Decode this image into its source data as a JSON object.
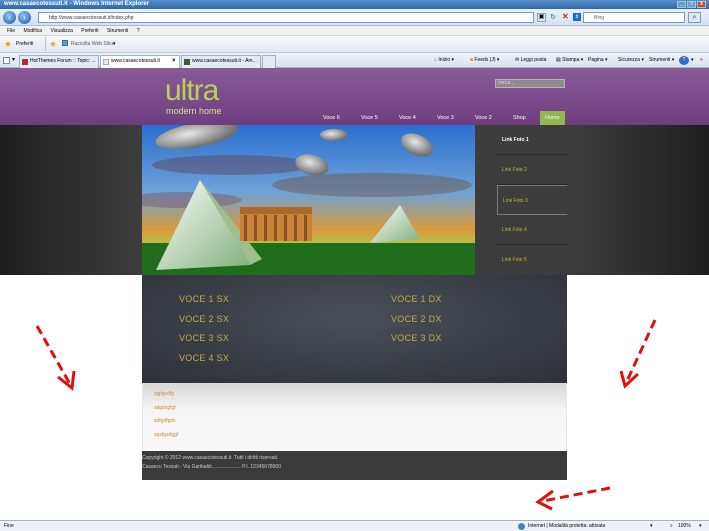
{
  "window": {
    "title": "www.casaecotessuti.it - Windows Internet Explorer"
  },
  "address": {
    "url": "http://www.casaecotessuti.it/index.php"
  },
  "search": {
    "placeholder": "Bing"
  },
  "menubar": [
    "File",
    "Modifica",
    "Visualizza",
    "Preferiti",
    "Strumenti",
    "?"
  ],
  "favbar": {
    "favorites": "Preferiti",
    "gallery": "Raccolta Web Slice"
  },
  "tabs": [
    {
      "label": "HotThemes Forum :: Topic: ..."
    },
    {
      "label": "www.casaecotessuti.it"
    },
    {
      "label": "www.casaecotessuti.it - Am..."
    }
  ],
  "commandbar": {
    "home": "Inizio",
    "feeds": "Feeds (J)",
    "mail": "Leggi posta",
    "print": "Stampa",
    "page": "Pagina",
    "safety": "Sicurezza",
    "tools": "Strumenti"
  },
  "site": {
    "logo_main": "ultra",
    "logo_sub": "modern home",
    "search_value": "cerca...",
    "nav": [
      "Voce 6",
      "Voce 5",
      "Voce 4",
      "Voce 3",
      "Voce 2",
      "Shop",
      "Home"
    ],
    "slider_links": [
      "Link Foto 1",
      "Link Foto 2",
      "Link Foto 3",
      "Link Foto 4",
      "Link Foto 5"
    ],
    "menu_left": [
      "VOCE 1 SX",
      "VOCE 2 SX",
      "VOCE 3 SX",
      "VOCE 4 SX"
    ],
    "menu_right": [
      "VOCE 1 DX",
      "VOCE 2 DX",
      "VOCE 3 DX"
    ],
    "small_links": [
      "sgjfgsdfg",
      "sdgdsgfgf",
      "sdfgdfgds",
      "sgsfgsdggf"
    ],
    "footer_line1": "Copyright © 2012 www.casaecotessuti.it. Tutti i diritti riservati.",
    "footer_line2": "Casaeco Tessuti - Via Garibaldi..................... P.I. 12345678900"
  },
  "status": {
    "left": "Fine",
    "zone": "Internet | Modalità protetta: attivata",
    "zoom": "100%"
  }
}
